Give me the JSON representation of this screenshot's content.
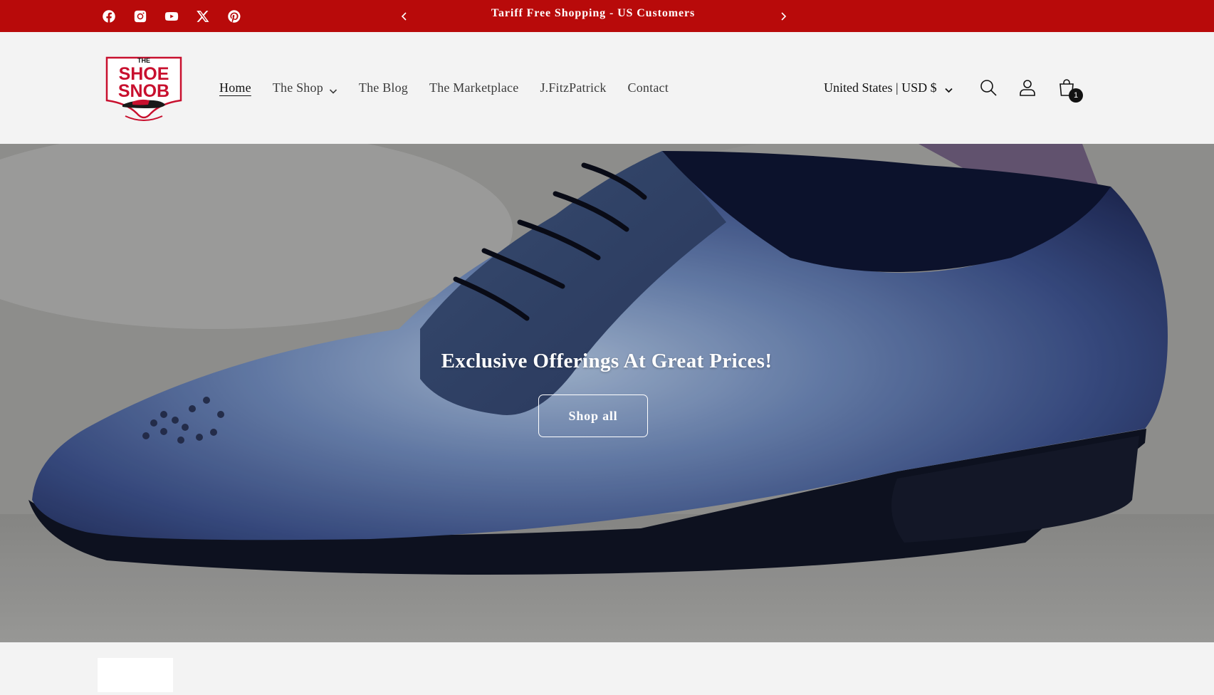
{
  "announcement": {
    "text": "Tariff Free Shopping - US Customers",
    "background": "#b80a0a",
    "social": [
      "facebook-icon",
      "instagram-icon",
      "youtube-icon",
      "x-icon",
      "pinterest-icon"
    ]
  },
  "header": {
    "logo_alt": "The Shoe Snob",
    "nav": [
      {
        "label": "Home",
        "active": true
      },
      {
        "label": "The Shop",
        "has_dropdown": true
      },
      {
        "label": "The Blog"
      },
      {
        "label": "The Marketplace"
      },
      {
        "label": "J.FitzPatrick"
      },
      {
        "label": "Contact"
      }
    ],
    "locale": "United States | USD $",
    "cart_count": "1"
  },
  "hero": {
    "title": "Exclusive Offerings At Great Prices!",
    "button_label": "Shop all"
  }
}
